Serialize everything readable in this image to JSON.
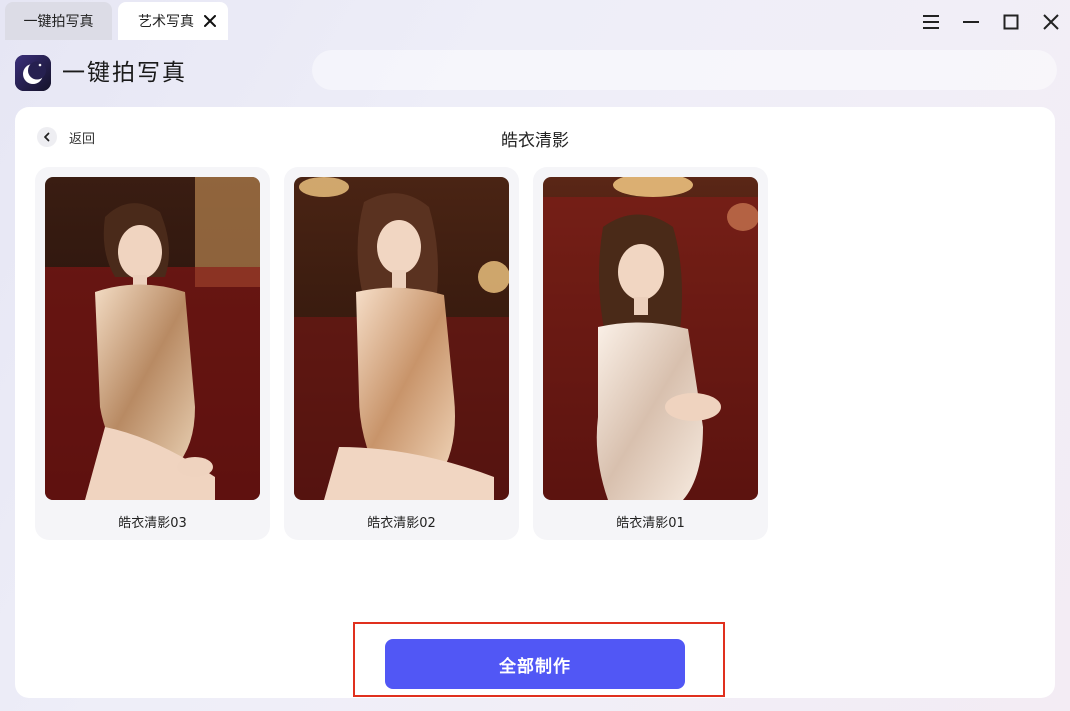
{
  "tabs": [
    {
      "label": "一键拍写真"
    },
    {
      "label": "艺术写真"
    }
  ],
  "app": {
    "title": "一键拍写真"
  },
  "page": {
    "back_label": "返回",
    "title": "皓衣清影"
  },
  "cards": [
    {
      "label": "皓衣清影03"
    },
    {
      "label": "皓衣清影02"
    },
    {
      "label": "皓衣清影01"
    }
  ],
  "actions": {
    "make_all_label": "全部制作"
  },
  "colors": {
    "accent": "#5157f5",
    "highlight": "#e0301e",
    "panel": "#ffffff"
  },
  "icons": {
    "tab_close": "close-icon",
    "menu": "menu-icon",
    "minimize": "minimize-icon",
    "maximize": "maximize-icon",
    "window_close": "close-icon",
    "back": "chevron-left-icon",
    "logo": "moon-logo-icon"
  }
}
